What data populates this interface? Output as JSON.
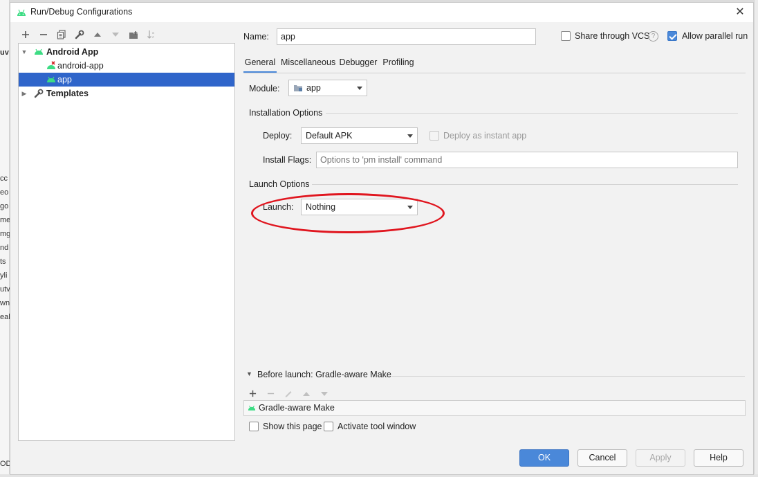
{
  "background_ide": {
    "fragments": [
      "uv",
      "cc",
      "eo",
      "go",
      "me",
      "mg",
      "nd",
      "ts",
      "yli",
      "utv",
      "wn",
      "eal",
      "OD"
    ]
  },
  "dialog": {
    "title": "Run/Debug Configurations",
    "close_label": "✕"
  },
  "toolbar": {
    "icons": [
      "add-icon",
      "remove-icon",
      "copy-icon",
      "wrench-icon",
      "move-up-icon",
      "move-down-icon",
      "folder-icon",
      "sort-icon"
    ]
  },
  "tree": {
    "items": [
      {
        "label": "Android App",
        "icon": "android-icon",
        "expanded": true,
        "bold": true
      },
      {
        "label": "android-app",
        "icon": "android-error-icon"
      },
      {
        "label": "app",
        "icon": "android-icon",
        "selected": true
      },
      {
        "label": "Templates",
        "icon": "wrench-icon",
        "expanded": false,
        "bold": true
      }
    ]
  },
  "header": {
    "name_label": "Name:",
    "name_value": "app",
    "share_label": "Share through VCS",
    "share_checked": false,
    "help_symbol": "?",
    "parallel_label": "Allow parallel run",
    "parallel_checked": true
  },
  "tabs": [
    {
      "label": "General",
      "active": true
    },
    {
      "label": "Miscellaneous"
    },
    {
      "label": "Debugger"
    },
    {
      "label": "Profiling"
    }
  ],
  "general": {
    "module_label": "Module:",
    "module_value": "app",
    "installation_title": "Installation Options",
    "deploy_label": "Deploy:",
    "deploy_value": "Default APK",
    "instant_label": "Deploy as instant app",
    "instant_checked": false,
    "flags_label": "Install Flags:",
    "flags_placeholder": "Options to 'pm install' command",
    "launch_options_title": "Launch Options",
    "launch_label": "Launch:",
    "launch_value": "Nothing"
  },
  "before_launch": {
    "title": "Before launch: Gradle-aware Make",
    "tasks": [
      "Gradle-aware Make"
    ],
    "show_page_label": "Show this page",
    "activate_label": "Activate tool window"
  },
  "buttons": {
    "ok": "OK",
    "cancel": "Cancel",
    "apply": "Apply",
    "help": "Help"
  },
  "colors": {
    "accent": "#4a88d9",
    "selection": "#2f65ca",
    "android_green": "#3ddc84",
    "annotation_red": "#e0161f"
  }
}
